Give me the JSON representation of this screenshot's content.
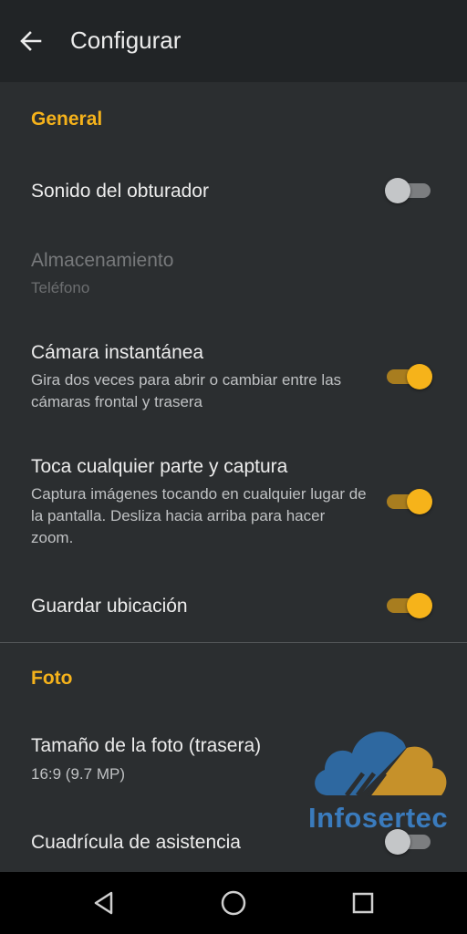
{
  "appbar": {
    "title": "Configurar",
    "back_icon": "arrow-left-icon"
  },
  "sections": {
    "general": {
      "header": "General",
      "shutter_sound": {
        "title": "Sonido del obturador",
        "enabled": false
      },
      "storage": {
        "title": "Almacenamiento",
        "value": "Teléfono",
        "disabled": true
      },
      "quick_camera": {
        "title": "Cámara instantánea",
        "description": "Gira dos veces para abrir o cambiar entre las cámaras frontal y trasera",
        "enabled": true
      },
      "touch_capture": {
        "title": "Toca cualquier parte y captura",
        "description": "Captura imágenes tocando en cualquier lugar de la pantalla. Desliza hacia arriba para hacer zoom.",
        "enabled": true
      },
      "save_location": {
        "title": "Guardar ubicación",
        "enabled": true
      }
    },
    "photo": {
      "header": "Foto",
      "photo_size": {
        "title": "Tamaño de la foto (trasera)",
        "value": "16:9 (9.7 MP)"
      },
      "grid": {
        "title": "Cuadrícula de asistencia",
        "enabled": false
      }
    }
  },
  "watermark": {
    "text": "Infosertec",
    "icon": "cloud-logo-icon"
  },
  "navbar": {
    "back_icon": "triangle-back-icon",
    "home_icon": "circle-home-icon",
    "recents_icon": "square-recents-icon"
  },
  "colors": {
    "accent": "#f5b21b",
    "background": "#2b2e30",
    "appbar": "#212426",
    "navbar": "#000000"
  }
}
